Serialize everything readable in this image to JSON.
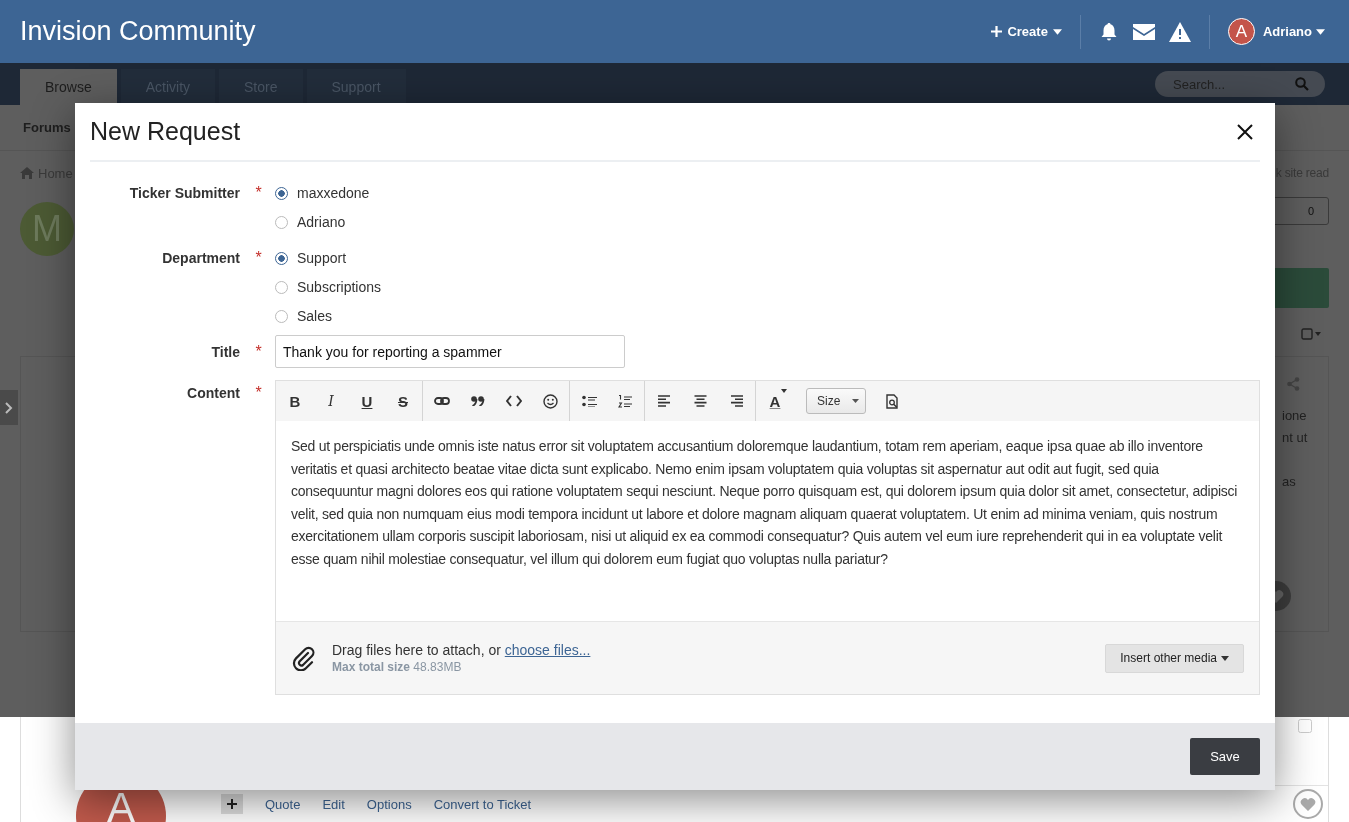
{
  "header": {
    "site_title": "Invision Community",
    "create_label": "Create",
    "user": {
      "name": "Adriano",
      "initial": "A"
    }
  },
  "nav": {
    "tabs": [
      {
        "label": "Browse",
        "selected": true
      },
      {
        "label": "Activity",
        "selected": false
      },
      {
        "label": "Store",
        "selected": false
      },
      {
        "label": "Support",
        "selected": false
      }
    ],
    "search": {
      "placeholder": "Search..."
    }
  },
  "subnav": {
    "items": [
      "Forums"
    ]
  },
  "breadcrumb": {
    "home": "Home",
    "right_text": "k site read"
  },
  "profile": {
    "initial": "M",
    "count": "0"
  },
  "post": {
    "lines": [
      "ione",
      "nt ut",
      "as"
    ]
  },
  "modal": {
    "title": "New Request",
    "required_mark": "*",
    "fields": [
      {
        "kind": "radio",
        "label": "Ticker Submitter",
        "required": true,
        "options": [
          {
            "label": "maxxedone",
            "selected": true
          },
          {
            "label": "Adriano",
            "selected": false
          }
        ]
      },
      {
        "kind": "radio",
        "label": "Department",
        "required": true,
        "options": [
          {
            "label": "Support",
            "selected": true
          },
          {
            "label": "Subscriptions",
            "selected": false
          },
          {
            "label": "Sales",
            "selected": false
          }
        ]
      },
      {
        "kind": "text",
        "label": "Title",
        "required": true,
        "value": "Thank you for reporting a spammer"
      },
      {
        "kind": "editor",
        "label": "Content",
        "required": true,
        "toolbar": [
          [
            {
              "kind": "bold",
              "glyph": "B"
            },
            {
              "kind": "italic",
              "glyph": "I"
            },
            {
              "kind": "underline",
              "glyph": "U"
            },
            {
              "kind": "strike",
              "glyph": "S"
            }
          ],
          [
            {
              "kind": "link"
            },
            {
              "kind": "quote"
            },
            {
              "kind": "code"
            },
            {
              "kind": "emoji"
            }
          ],
          [
            {
              "kind": "bullets"
            },
            {
              "kind": "numbers"
            }
          ],
          [
            {
              "kind": "align-left"
            },
            {
              "kind": "align-center"
            },
            {
              "kind": "align-right"
            }
          ],
          [
            {
              "kind": "color",
              "glyph": "A"
            },
            {
              "kind": "size",
              "label": "Size"
            },
            {
              "kind": "preview"
            }
          ]
        ],
        "body": "Sed ut perspiciatis unde omnis iste natus error sit voluptatem accusantium doloremque laudantium, totam rem aperiam, eaque ipsa quae ab illo inventore veritatis et quasi architecto beatae vitae dicta sunt explicabo. Nemo enim ipsam voluptatem quia voluptas sit aspernatur aut odit aut fugit, sed quia consequuntur magni dolores eos qui ratione voluptatem sequi nesciunt. Neque porro quisquam est, qui dolorem ipsum quia dolor sit amet, consectetur, adipisci velit, sed quia non numquam eius modi tempora incidunt ut labore et dolore magnam aliquam quaerat voluptatem. Ut enim ad minima veniam, quis nostrum exercitationem ullam corporis suscipit laboriosam, nisi ut aliquid ex ea commodi consequatur? Quis autem vel eum iure reprehenderit qui in ea voluptate velit esse quam nihil molestiae consequatur, vel illum qui dolorem eum fugiat quo voluptas nulla pariatur?",
        "attach_text": "Drag files here to attach, or",
        "attach_link": "choose files...",
        "max_label": "Max total size",
        "max_value": "48.83MB",
        "media_button": "Insert other media"
      }
    ],
    "save": "Save"
  },
  "reply_post": {
    "initial": "A",
    "actions": [
      "Quote",
      "Edit",
      "Options",
      "Convert to Ticket"
    ]
  }
}
